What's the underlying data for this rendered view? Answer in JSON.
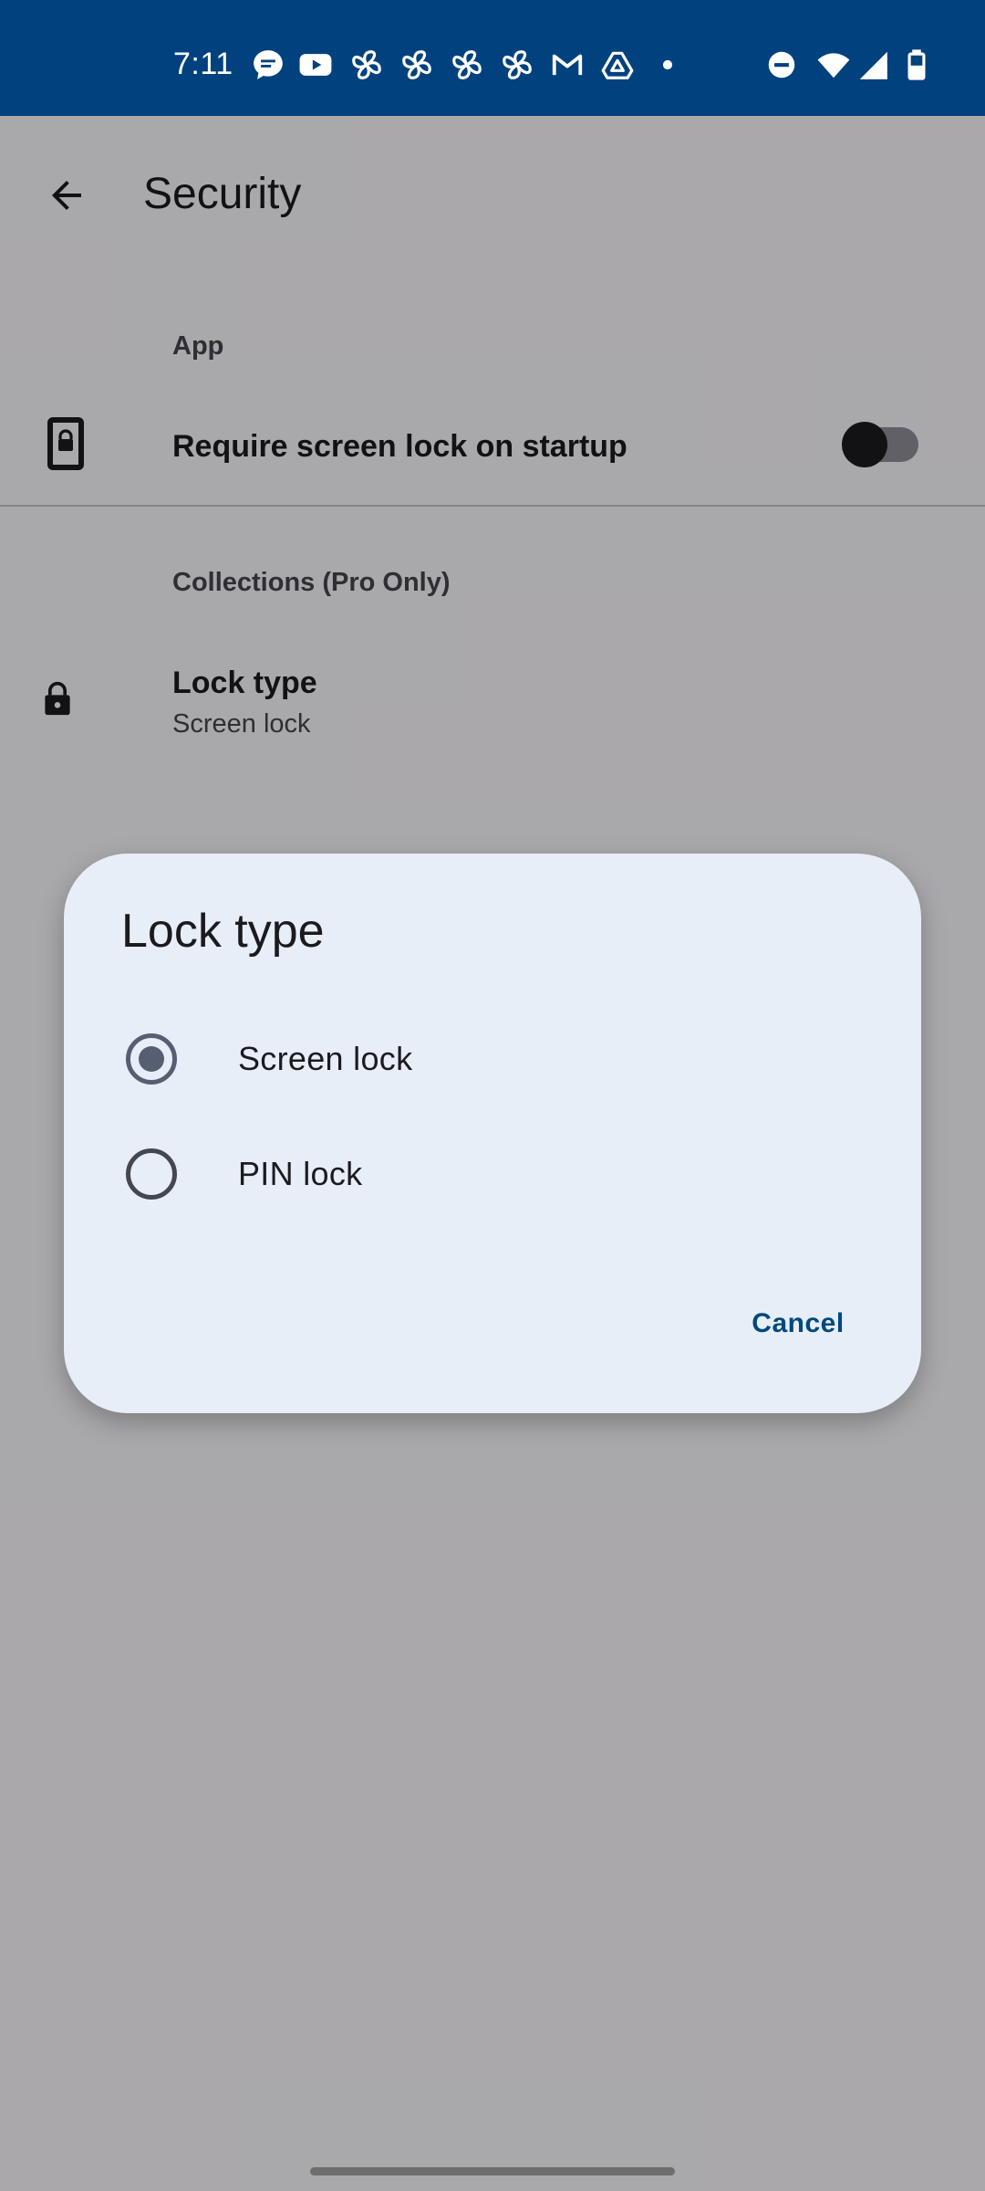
{
  "status_bar": {
    "time": "7:11",
    "background": "#00417e",
    "left_icons": [
      "messages-icon",
      "youtube-icon",
      "pinwheel-icon",
      "pinwheel-icon",
      "pinwheel-icon",
      "pinwheel-icon",
      "gmail-icon",
      "drive-icon",
      "dot-icon"
    ],
    "right_icons": [
      "do-not-disturb-icon",
      "wifi-icon",
      "signal-icon",
      "battery-icon"
    ]
  },
  "app_bar": {
    "title": "Security",
    "back_icon": "arrow-back-icon"
  },
  "settings": {
    "section_app": "App",
    "require_lock_title": "Require screen lock on startup",
    "require_lock_enabled": false,
    "require_lock_icon": "phone-lock-icon",
    "section_collections": "Collections (Pro Only)",
    "lock_type_title": "Lock type",
    "lock_type_summary": "Screen lock",
    "lock_type_icon": "lock-icon"
  },
  "dialog": {
    "title": "Lock type",
    "options": [
      {
        "label": "Screen lock",
        "selected": true
      },
      {
        "label": "PIN lock",
        "selected": false
      }
    ],
    "cancel_label": "Cancel",
    "background": "#e8eef8",
    "accent": "#00497d"
  }
}
